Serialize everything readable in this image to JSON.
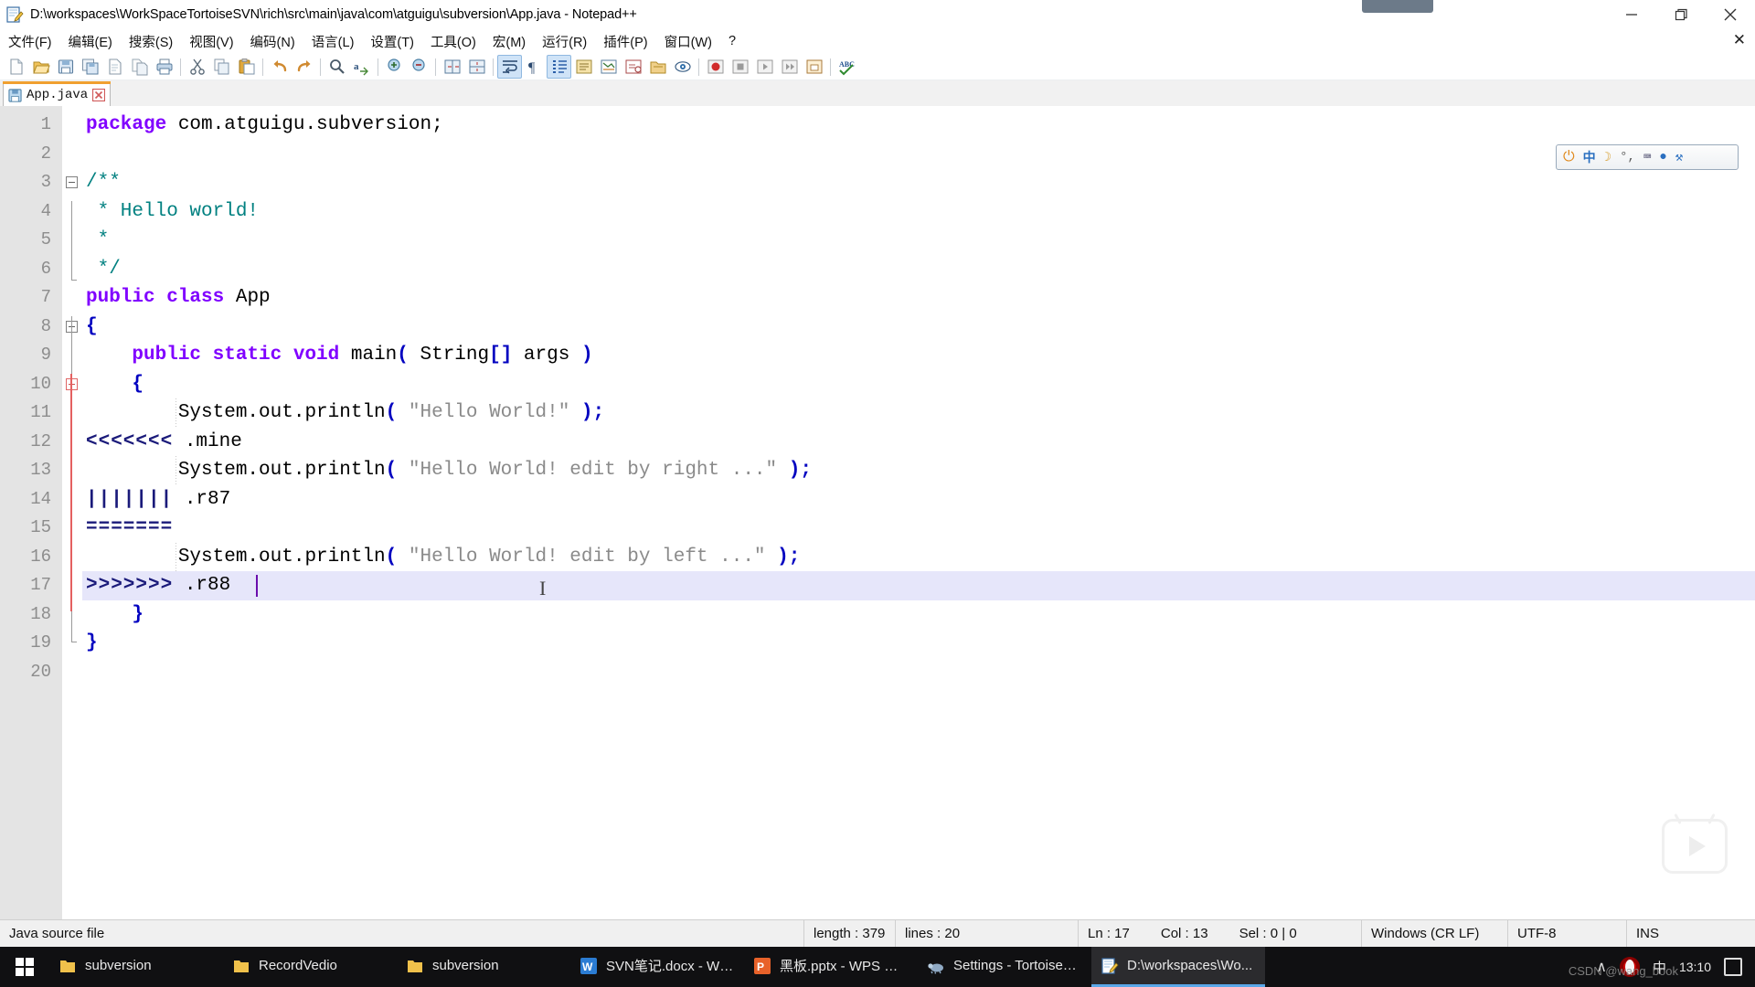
{
  "window": {
    "title": "D:\\workspaces\\WorkSpaceTortoiseSVN\\rich\\src\\main\\java\\com\\atguigu\\subversion\\App.java - Notepad++",
    "app_icon": "notepad-plus-plus-icon",
    "minimize_label": "Minimize",
    "maximize_label": "Restore",
    "close_label": "Close"
  },
  "menu": {
    "items": [
      {
        "label": "文件(F)",
        "name": "menu-file"
      },
      {
        "label": "编辑(E)",
        "name": "menu-edit"
      },
      {
        "label": "搜索(S)",
        "name": "menu-search"
      },
      {
        "label": "视图(V)",
        "name": "menu-view"
      },
      {
        "label": "编码(N)",
        "name": "menu-encoding"
      },
      {
        "label": "语言(L)",
        "name": "menu-language"
      },
      {
        "label": "设置(T)",
        "name": "menu-settings"
      },
      {
        "label": "工具(O)",
        "name": "menu-tools"
      },
      {
        "label": "宏(M)",
        "name": "menu-macro"
      },
      {
        "label": "运行(R)",
        "name": "menu-run"
      },
      {
        "label": "插件(P)",
        "name": "menu-plugins"
      },
      {
        "label": "窗口(W)",
        "name": "menu-window"
      },
      {
        "label": "?",
        "name": "menu-help"
      }
    ],
    "close_document": "✕"
  },
  "toolbar": {
    "buttons": [
      {
        "name": "new-file-icon",
        "title": "新建"
      },
      {
        "name": "open-file-icon",
        "title": "打开"
      },
      {
        "name": "save-file-icon",
        "title": "保存"
      },
      {
        "name": "save-all-icon",
        "title": "保存所有"
      },
      {
        "name": "close-file-icon",
        "title": "关闭"
      },
      {
        "name": "close-all-icon",
        "title": "关闭所有"
      },
      {
        "name": "print-icon",
        "title": "打印"
      },
      {
        "name": "cut-icon",
        "title": "剪切"
      },
      {
        "name": "copy-icon",
        "title": "复制"
      },
      {
        "name": "paste-icon",
        "title": "粘贴"
      },
      {
        "name": "undo-icon",
        "title": "撤销"
      },
      {
        "name": "redo-icon",
        "title": "重做"
      },
      {
        "name": "find-icon",
        "title": "查找"
      },
      {
        "name": "replace-icon",
        "title": "替换"
      },
      {
        "name": "zoom-in-icon",
        "title": "放大"
      },
      {
        "name": "zoom-out-icon",
        "title": "缩小"
      },
      {
        "name": "sync-vertical-icon",
        "title": "同步垂直滚动"
      },
      {
        "name": "sync-horizontal-icon",
        "title": "同步水平滚动"
      },
      {
        "name": "word-wrap-icon",
        "title": "自动换行"
      },
      {
        "name": "show-all-chars-icon",
        "title": "显示所有字符"
      },
      {
        "name": "indent-guide-icon",
        "title": "显示缩进参考线"
      },
      {
        "name": "user-define-dialog-icon",
        "title": "用户自定义语言"
      },
      {
        "name": "document-map-icon",
        "title": "文档地图"
      },
      {
        "name": "function-list-icon",
        "title": "函数列表"
      },
      {
        "name": "folder-workspace-icon",
        "title": "文件夹作为工作区"
      },
      {
        "name": "monitoring-icon",
        "title": "监视文件"
      },
      {
        "name": "record-macro-icon",
        "title": "开始录制宏"
      },
      {
        "name": "stop-macro-icon",
        "title": "停止录制宏"
      },
      {
        "name": "play-macro-icon",
        "title": "回放宏"
      },
      {
        "name": "play-macro-multi-icon",
        "title": "多次回放宏"
      },
      {
        "name": "save-macro-icon",
        "title": "保存当前录制的宏"
      },
      {
        "name": "spell-check-icon",
        "title": "拼写检查"
      }
    ]
  },
  "tabs": [
    {
      "label": "App.java",
      "name": "tab-app-java",
      "active": true,
      "modified": false
    }
  ],
  "ime_toolbar": {
    "items": [
      "⏻",
      "中",
      "☽",
      "°,",
      "⌨",
      "●",
      "⚒"
    ]
  },
  "editor": {
    "total_lines": 20,
    "current_line": 17,
    "lines": [
      {
        "n": 1,
        "segments": [
          {
            "t": "kw",
            "v": "package"
          },
          {
            "t": "plain",
            "v": " com.atguigu.subversion;"
          }
        ]
      },
      {
        "n": 2,
        "segments": []
      },
      {
        "n": 3,
        "segments": [
          {
            "t": "cmt",
            "v": "/**"
          }
        ]
      },
      {
        "n": 4,
        "segments": [
          {
            "t": "cmt",
            "v": " * Hello world!"
          }
        ]
      },
      {
        "n": 5,
        "segments": [
          {
            "t": "cmt",
            "v": " *"
          }
        ]
      },
      {
        "n": 6,
        "segments": [
          {
            "t": "cmt",
            "v": " */"
          }
        ]
      },
      {
        "n": 7,
        "segments": [
          {
            "t": "kw",
            "v": "public class"
          },
          {
            "t": "plain",
            "v": " App"
          }
        ]
      },
      {
        "n": 8,
        "segments": [
          {
            "t": "op",
            "v": "{"
          }
        ]
      },
      {
        "n": 9,
        "segments": [
          {
            "t": "plain",
            "v": "    "
          },
          {
            "t": "kw",
            "v": "public static void"
          },
          {
            "t": "plain",
            "v": " main"
          },
          {
            "t": "op",
            "v": "("
          },
          {
            "t": "plain",
            "v": " String"
          },
          {
            "t": "op",
            "v": "[]"
          },
          {
            "t": "plain",
            "v": " args "
          },
          {
            "t": "op",
            "v": ")"
          }
        ]
      },
      {
        "n": 10,
        "segments": [
          {
            "t": "plain",
            "v": "    "
          },
          {
            "t": "op",
            "v": "{"
          }
        ]
      },
      {
        "n": 11,
        "segments": [
          {
            "t": "plain",
            "v": "        System.out.println"
          },
          {
            "t": "op",
            "v": "("
          },
          {
            "t": "str",
            "v": " \"Hello World!\" "
          },
          {
            "t": "op",
            "v": ");"
          }
        ]
      },
      {
        "n": 12,
        "segments": [
          {
            "t": "conflict",
            "v": "<<<<<<<"
          },
          {
            "t": "plain",
            "v": " .mine"
          }
        ]
      },
      {
        "n": 13,
        "segments": [
          {
            "t": "plain",
            "v": "        System.out.println"
          },
          {
            "t": "op",
            "v": "("
          },
          {
            "t": "str",
            "v": " \"Hello World! edit by right ...\" "
          },
          {
            "t": "op",
            "v": ");"
          }
        ]
      },
      {
        "n": 14,
        "segments": [
          {
            "t": "conflict",
            "v": "|||||||"
          },
          {
            "t": "plain",
            "v": " .r87"
          }
        ]
      },
      {
        "n": 15,
        "segments": [
          {
            "t": "conflict",
            "v": "======="
          }
        ]
      },
      {
        "n": 16,
        "segments": [
          {
            "t": "plain",
            "v": "        System.out.println"
          },
          {
            "t": "op",
            "v": "("
          },
          {
            "t": "str",
            "v": " \"Hello World! edit by left ...\" "
          },
          {
            "t": "op",
            "v": ");"
          }
        ]
      },
      {
        "n": 17,
        "segments": [
          {
            "t": "conflict",
            "v": ">>>>>>>"
          },
          {
            "t": "plain",
            "v": " .r88"
          }
        ]
      },
      {
        "n": 18,
        "segments": [
          {
            "t": "plain",
            "v": "    "
          },
          {
            "t": "op",
            "v": "}"
          }
        ]
      },
      {
        "n": 19,
        "segments": [
          {
            "t": "op",
            "v": "}"
          }
        ]
      },
      {
        "n": 20,
        "segments": []
      }
    ]
  },
  "statusbar": {
    "doc_type": "Java source file",
    "length_label": "length : 379",
    "lines_label": "lines : 20",
    "ln": "Ln : 17",
    "col": "Col : 13",
    "sel": "Sel : 0 | 0",
    "eol": "Windows (CR LF)",
    "encoding": "UTF-8",
    "mode": "INS"
  },
  "taskbar": {
    "start_label": "Start",
    "items": [
      {
        "label": "subversion",
        "icon": "folder-icon",
        "open": false,
        "name": "taskbar-item-subversion-1"
      },
      {
        "label": "RecordVedio",
        "icon": "folder-icon",
        "open": false,
        "name": "taskbar-item-recordvedio"
      },
      {
        "label": "subversion",
        "icon": "folder-icon",
        "open": false,
        "name": "taskbar-item-subversion-2"
      },
      {
        "label": "SVN笔记.docx - WP...",
        "icon": "wps-word-icon",
        "open": false,
        "name": "taskbar-item-svn-notes"
      },
      {
        "label": "黑板.pptx - WPS 演示",
        "icon": "wps-ppt-icon",
        "open": false,
        "name": "taskbar-item-blackboard-ppt"
      },
      {
        "label": "Settings - TortoiseS...",
        "icon": "tortoisesvn-icon",
        "open": false,
        "name": "taskbar-item-tortoisesvn-settings"
      },
      {
        "label": "D:\\workspaces\\Wo...",
        "icon": "notepad-plus-plus-icon",
        "open": true,
        "name": "taskbar-item-notepadpp"
      }
    ],
    "tray": {
      "chevron": "∧",
      "browser_icon": "opera-icon",
      "ime_label": "中",
      "clock_time": "13:10",
      "note_icon": "notes-icon"
    },
    "watermark": "CSDN @wang_book"
  },
  "colors": {
    "keyword": "#8000ff",
    "comment": "#008080",
    "string": "#8a8a8a",
    "operator": "#0000c0",
    "conflict_marker": "#1a1a7a",
    "current_line_bg": "#e6e6fa",
    "gutter_bg": "#e4e4e4",
    "tab_accent": "#f0a030",
    "taskbar_bg": "#101012",
    "taskbar_active": "#5aa7e8"
  }
}
